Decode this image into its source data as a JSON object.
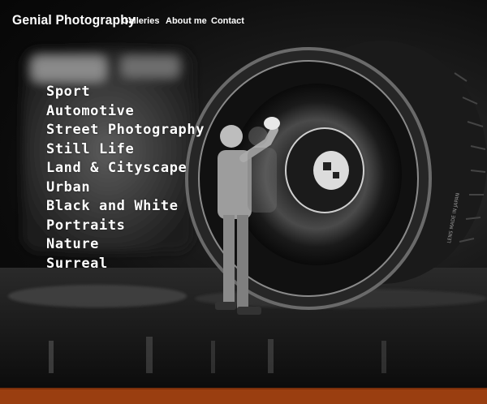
{
  "header": {
    "brand": "Genial Photography",
    "nav": [
      {
        "label": "Galleries"
      },
      {
        "label": "About me"
      },
      {
        "label": "Contact"
      }
    ]
  },
  "categories": [
    "Sport",
    "Automotive",
    "Street Photography",
    "Still Life",
    "Land & Cityscape",
    "Urban",
    "Black and White",
    "Portraits",
    "Nature",
    "Surreal"
  ],
  "hero_image": {
    "description_icon": "camera-lens-with-miniature-cleaner-photo",
    "lens_text": "LENS MADE IN JAPAN"
  },
  "colors": {
    "background": "#0d0d0d",
    "text": "#ffffff",
    "footer_bar": "#9a3e10"
  }
}
